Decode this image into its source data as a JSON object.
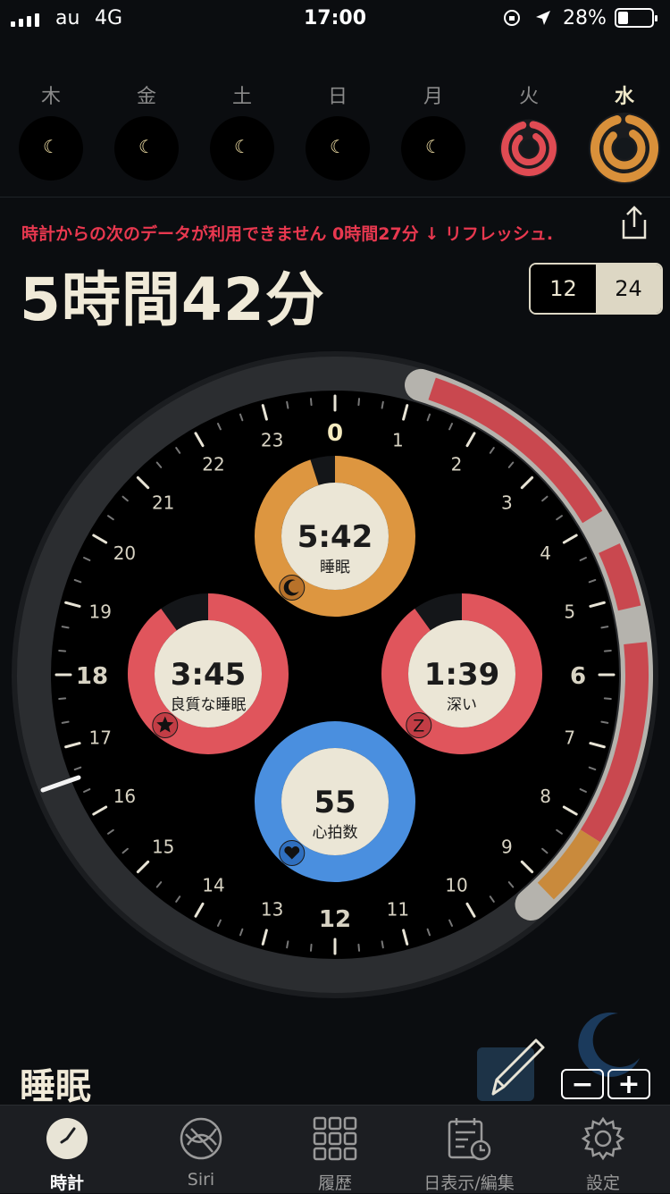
{
  "status_bar": {
    "carrier": "au",
    "network": "4G",
    "time": "17:00",
    "battery": "28%"
  },
  "days": [
    {
      "label": "木",
      "state": "no-data"
    },
    {
      "label": "金",
      "state": "no-data"
    },
    {
      "label": "土",
      "state": "no-data"
    },
    {
      "label": "日",
      "state": "no-data"
    },
    {
      "label": "月",
      "state": "no-data"
    },
    {
      "label": "火",
      "state": "ring",
      "color": "#e04b53"
    },
    {
      "label": "水",
      "state": "ring",
      "color": "#d9903a",
      "selected": true
    }
  ],
  "warning": "時計からの次のデータが利用できません 0時間27分 ↓ リフレッシュ.",
  "total_sleep": "5時間42分",
  "format_toggle": {
    "option_12": "12",
    "option_24": "24",
    "selected": "24"
  },
  "dial": {
    "hours": [
      "0",
      "1",
      "2",
      "3",
      "4",
      "5",
      "6",
      "7",
      "8",
      "9",
      "10",
      "11",
      "12",
      "13",
      "14",
      "15",
      "16",
      "17",
      "18",
      "19",
      "20",
      "21",
      "22",
      "23"
    ],
    "sleep_arc_start_hour": 1.1,
    "sleep_arc_end_hour": 9.3
  },
  "metrics": {
    "sleep": {
      "value": "5:42",
      "label": "睡眠",
      "color": "#dd9640",
      "fraction": 0.95
    },
    "quality": {
      "value": "3:45",
      "label": "良質な睡眠",
      "color": "#e0555c",
      "fraction": 0.9
    },
    "deep": {
      "value": "1:39",
      "label": "深い",
      "color": "#e0555c",
      "fraction": 0.9
    },
    "heart": {
      "value": "55",
      "label": "心拍数",
      "color": "#4a8fdf",
      "fraction": 1.0
    }
  },
  "section_title": "睡眠",
  "zoom": {
    "minus": "−",
    "plus": "+"
  },
  "tabs": [
    {
      "label": "時計",
      "icon": "clock-icon",
      "active": true
    },
    {
      "label": "Siri",
      "icon": "siri-icon"
    },
    {
      "label": "履歴",
      "icon": "grid-icon"
    },
    {
      "label": "日表示/編集",
      "icon": "calendar-icon"
    },
    {
      "label": "設定",
      "icon": "gear-icon"
    }
  ],
  "colors": {
    "accent_orange": "#dd9640",
    "accent_red": "#e0555c",
    "accent_blue": "#4a8fdf",
    "warning": "#e8384f"
  }
}
